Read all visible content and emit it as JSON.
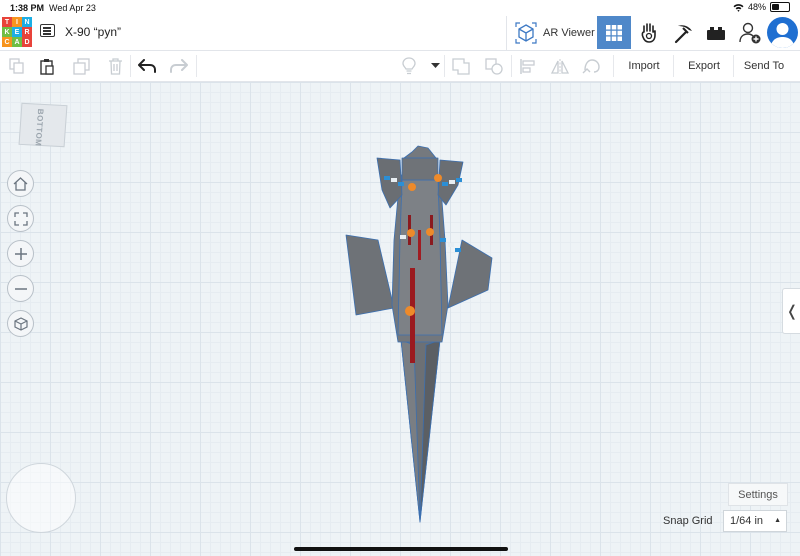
{
  "status_bar": {
    "time": "1:38 PM",
    "date": "Wed Apr 23",
    "battery": "48%"
  },
  "logo_letters": [
    {
      "ch": "T",
      "color": "#e8433a"
    },
    {
      "ch": "I",
      "color": "#f7941d"
    },
    {
      "ch": "N",
      "color": "#1caee4"
    },
    {
      "ch": "K",
      "color": "#6fbe44"
    },
    {
      "ch": "E",
      "color": "#1caee4"
    },
    {
      "ch": "R",
      "color": "#e8433a"
    },
    {
      "ch": "C",
      "color": "#f7941d"
    },
    {
      "ch": "A",
      "color": "#6fbe44"
    },
    {
      "ch": "D",
      "color": "#e8433a"
    }
  ],
  "header": {
    "design_title": "X-90 “pyn”",
    "ar_viewer_label": "AR Viewer"
  },
  "toolbar": {
    "import_label": "Import",
    "export_label": "Export",
    "send_to_label": "Send To"
  },
  "workplane": {
    "view_cube_face": "BOTTOM",
    "settings_label": "Settings",
    "snap_grid_label": "Snap Grid",
    "snap_grid_value": "1/64 in",
    "side_panel_toggle": "❬"
  },
  "colors": {
    "accent": "#4f88c9",
    "model_body": "#6f7378",
    "grid_bg": "#eef3f6"
  }
}
